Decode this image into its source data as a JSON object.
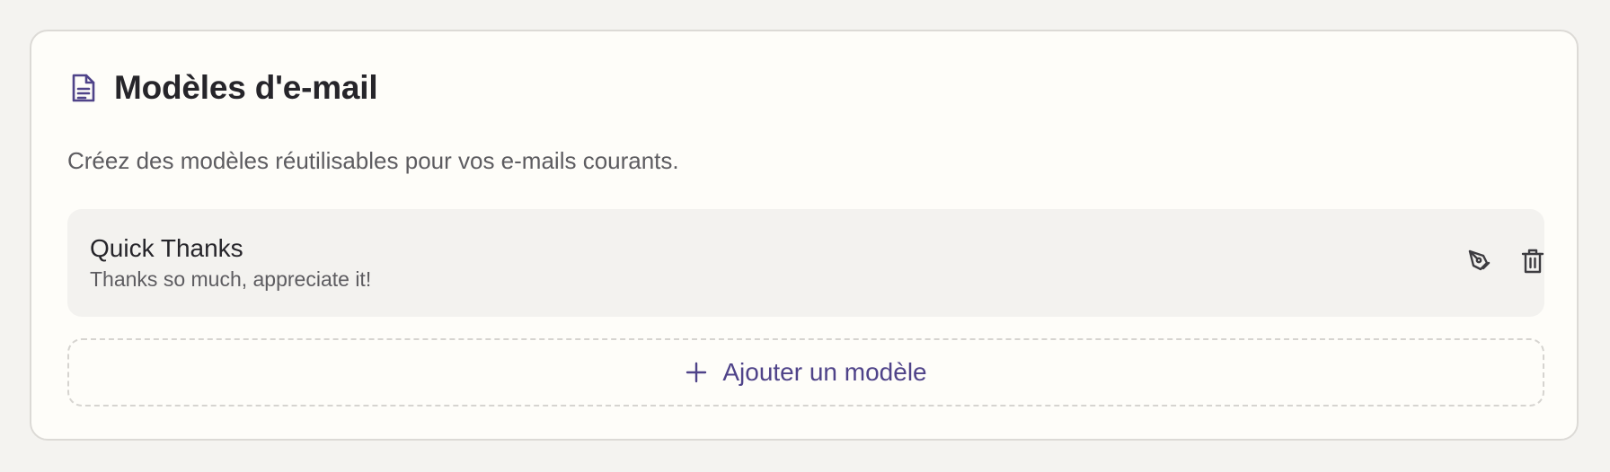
{
  "card": {
    "title": "Modèles d'e-mail",
    "title_icon": "document-icon",
    "description": "Créez des modèles réutilisables pour vos e-mails courants."
  },
  "templates": [
    {
      "name": "Quick Thanks",
      "preview": "Thanks so much, appreciate it!",
      "actions": [
        "edit-icon",
        "trash-icon"
      ]
    }
  ],
  "add_button": {
    "label": "Ajouter un modèle",
    "icon": "plus-icon"
  },
  "colors": {
    "accent": "#4f4389",
    "card_background": "#fefdf9",
    "row_background": "#f3f2ef",
    "page_background": "#f4f3f0"
  }
}
